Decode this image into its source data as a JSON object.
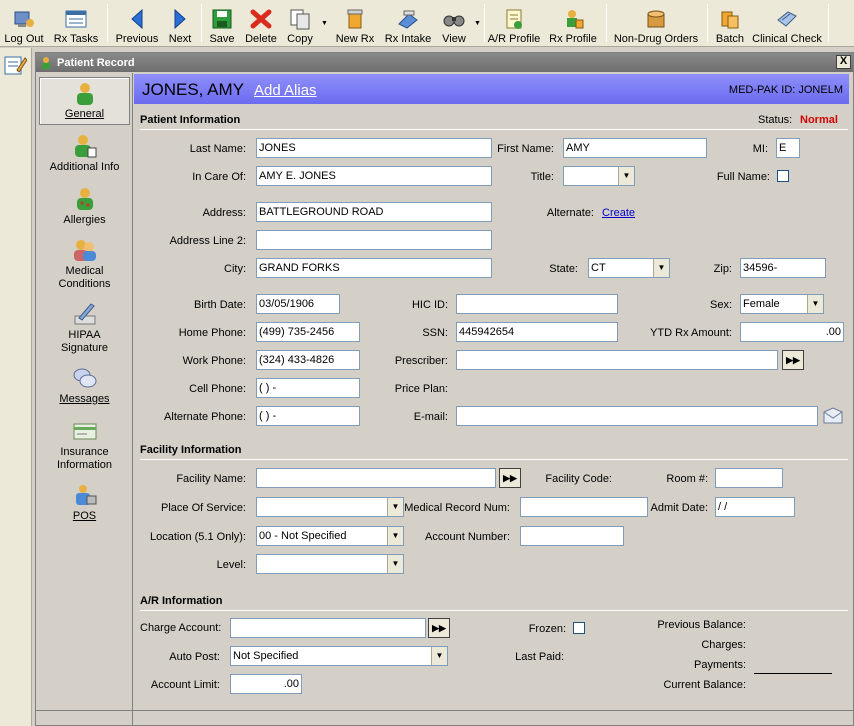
{
  "toolbar": {
    "logout": "Log Out",
    "rx_tasks": "Rx Tasks",
    "previous": "Previous",
    "next": "Next",
    "save": "Save",
    "delete": "Delete",
    "copy": "Copy",
    "new_rx": "New Rx",
    "rx_intake": "Rx Intake",
    "view": "View",
    "ar_profile": "A/R Profile",
    "rx_profile": "Rx Profile",
    "non_drug_orders": "Non-Drug Orders",
    "batch": "Batch",
    "clinical_check": "Clinical Check"
  },
  "window": {
    "title": "Patient Record",
    "close": "X"
  },
  "nav": [
    {
      "label": "General"
    },
    {
      "label": "Additional Info"
    },
    {
      "label": "Allergies"
    },
    {
      "label": "Medical Conditions"
    },
    {
      "label": "HIPAA Signature"
    },
    {
      "label": "Messages"
    },
    {
      "label": "Insurance Information"
    },
    {
      "label": "POS"
    }
  ],
  "header": {
    "name": "JONES, AMY",
    "add_alias": "Add Alias",
    "medpak_id": "MED-PAK ID: JONELM"
  },
  "patient": {
    "section_title": "Patient Information",
    "status_label": "Status:",
    "status_value": "Normal",
    "last_name_label": "Last Name:",
    "last_name": "JONES",
    "first_name_label": "First Name:",
    "first_name": "AMY",
    "mi_label": "MI:",
    "mi": "E",
    "in_care_of_label": "In Care Of:",
    "in_care_of": "AMY E. JONES",
    "title_label": "Title:",
    "title": "",
    "full_name_label": "Full Name:",
    "address_label": "Address:",
    "address": "BATTLEGROUND ROAD",
    "alternate_label": "Alternate:",
    "alternate_create": "Create",
    "address2_label": "Address Line 2:",
    "address2": "",
    "city_label": "City:",
    "city": "GRAND FORKS",
    "state_label": "State:",
    "state": "CT",
    "zip_label": "Zip:",
    "zip": "34596-",
    "birth_date_label": "Birth Date:",
    "birth_date": "03/05/1906",
    "hic_label": "HIC ID:",
    "hic": "",
    "sex_label": "Sex:",
    "sex": "Female",
    "home_phone_label": "Home Phone:",
    "home_phone": "(499) 735-2456",
    "ssn_label": "SSN:",
    "ssn": "445942654",
    "ytd_label": "YTD Rx Amount:",
    "ytd": ".00",
    "work_phone_label": "Work Phone:",
    "work_phone": "(324) 433-4826",
    "prescriber_label": "Prescriber:",
    "prescriber": "",
    "cell_phone_label": "Cell Phone:",
    "cell_phone": "(   )    -",
    "price_plan_label": "Price Plan:",
    "alt_phone_label": "Alternate Phone:",
    "alt_phone": "(   )    -",
    "email_label": "E-mail:",
    "email": ""
  },
  "facility": {
    "section_title": "Facility Information",
    "facility_name_label": "Facility Name:",
    "facility_name": "",
    "facility_code_label": "Facility Code:",
    "room_label": "Room #:",
    "room": "",
    "place_label": "Place Of Service:",
    "place": "",
    "mrn_label": "Medical Record Num:",
    "mrn": "",
    "admit_label": "Admit Date:",
    "admit": " / /",
    "location_label": "Location (5.1 Only):",
    "location": "00 - Not Specified",
    "account_label": "Account Number:",
    "account": "",
    "level_label": "Level:",
    "level": ""
  },
  "ar": {
    "section_title": "A/R Information",
    "charge_label": "Charge Account:",
    "charge": "",
    "frozen_label": "Frozen:",
    "prev_balance_label": "Previous Balance:",
    "charges_label": "Charges:",
    "autopost_label": "Auto Post:",
    "autopost": "Not Specified",
    "last_paid_label": "Last Paid:",
    "payments_label": "Payments:",
    "limit_label": "Account Limit:",
    "limit": ".00",
    "current_balance_label": "Current Balance:"
  }
}
